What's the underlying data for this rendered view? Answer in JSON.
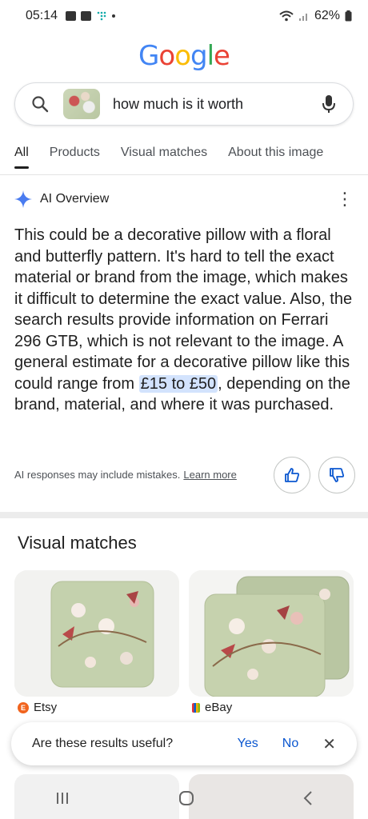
{
  "status": {
    "time": "05:14",
    "battery": "62%"
  },
  "logo": {
    "letters": [
      "G",
      "o",
      "o",
      "g",
      "l",
      "e"
    ]
  },
  "search": {
    "query": "how much is it worth"
  },
  "tabs": [
    {
      "label": "All"
    },
    {
      "label": "Products"
    },
    {
      "label": "Visual matches"
    },
    {
      "label": "About this image"
    }
  ],
  "ai_overview": {
    "title": "AI Overview",
    "text_before": "This could be a decorative pillow with a floral and butterfly pattern. It's hard to tell the exact material or brand from the image, which makes it difficult to determine the exact value. Also, the search results provide information on Ferrari 296 GTB, which is not relevant to the image. A general estimate for a decorative pillow like this could range from ",
    "highlight": "£15 to £50",
    "text_after": ", depending on the brand, material, and where it was purchased.",
    "disclaimer": "AI responses may include mistakes.",
    "learn_more": "Learn more"
  },
  "visual_matches": {
    "title": "Visual matches",
    "items": [
      {
        "source": "Etsy"
      },
      {
        "source": "eBay"
      }
    ]
  },
  "feedback": {
    "question": "Are these results useful?",
    "yes": "Yes",
    "no": "No"
  },
  "colors": {
    "accent": "#0b57d0",
    "highlight": "#d3e3fd"
  }
}
